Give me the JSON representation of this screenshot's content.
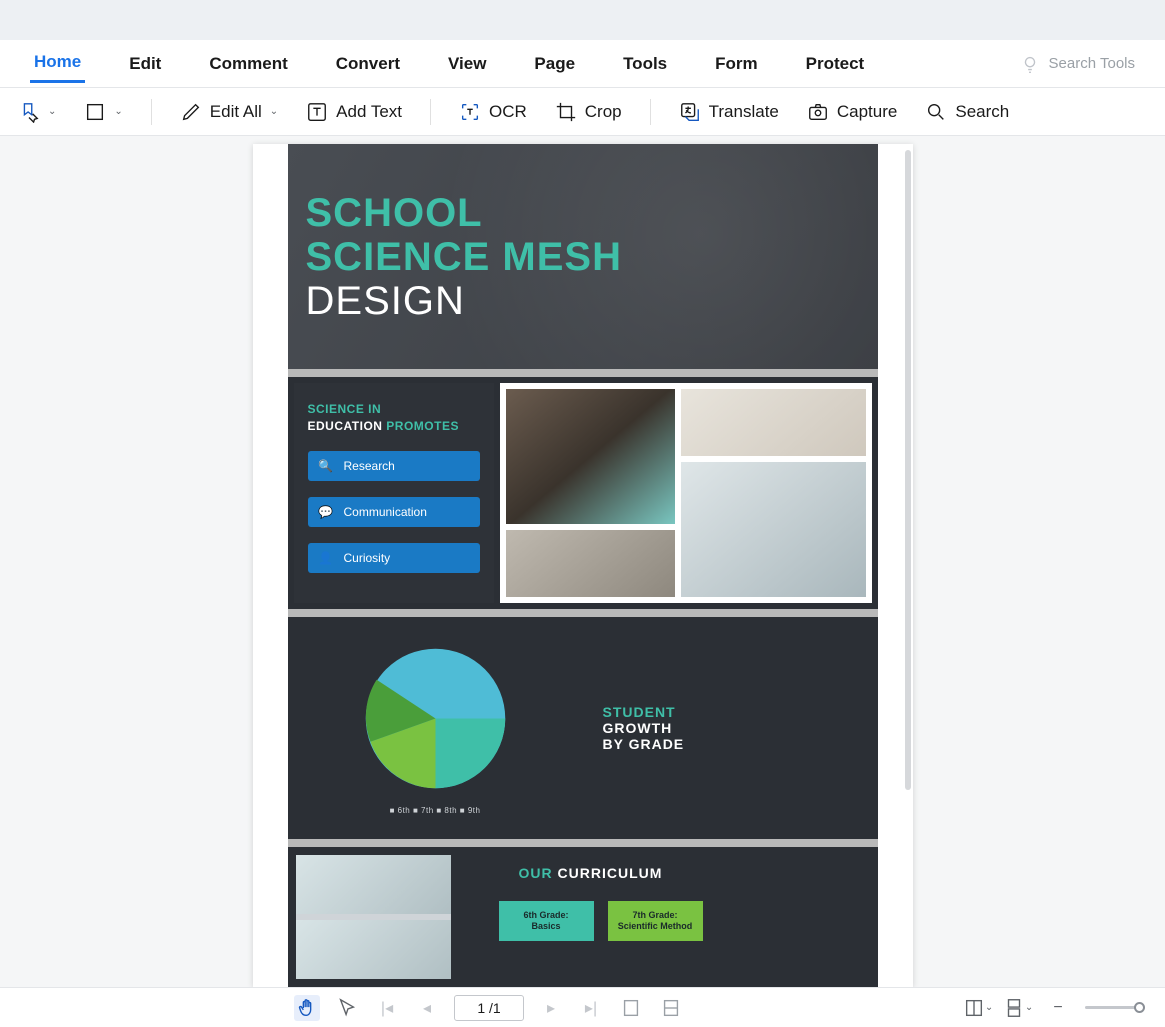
{
  "menu": {
    "items": [
      "Home",
      "Edit",
      "Comment",
      "Convert",
      "View",
      "Page",
      "Tools",
      "Form",
      "Protect"
    ],
    "activeIndex": 0,
    "searchPlaceholder": "Search Tools"
  },
  "toolbar": {
    "editAll": "Edit All",
    "addText": "Add Text",
    "ocr": "OCR",
    "crop": "Crop",
    "translate": "Translate",
    "capture": "Capture",
    "search": "Search"
  },
  "doc": {
    "title": {
      "l1": "SCHOOL",
      "l2": "SCIENCE MESH",
      "l3": "DESIGN"
    },
    "promotes": {
      "line1": "SCIENCE IN",
      "line2": "EDUCATION",
      "line3": "PROMOTES",
      "items": [
        "Research",
        "Communication",
        "Curiosity"
      ]
    },
    "growth": {
      "t1": "STUDENT",
      "t2": "GROWTH",
      "t3": "BY GRADE"
    },
    "legend": "■ 6th  ■ 7th  ■ 8th  ■ 9th",
    "curriculum": {
      "heading_our": "OUR",
      "heading_rest": "CURRICULUM",
      "box1l1": "6th Grade:",
      "box1l2": "Basics",
      "box2l1": "7th Grade:",
      "box2l2": "Scientific Method"
    }
  },
  "chart_data": {
    "type": "pie",
    "title": "Student Growth by Grade",
    "categories": [
      "6th",
      "7th",
      "8th",
      "9th"
    ],
    "values": [
      40,
      25,
      20,
      15
    ],
    "colors": [
      "#4fbcd6",
      "#3fbfa8",
      "#7ac241",
      "#4a9e3a"
    ]
  },
  "status": {
    "page": "1",
    "total": "1"
  }
}
